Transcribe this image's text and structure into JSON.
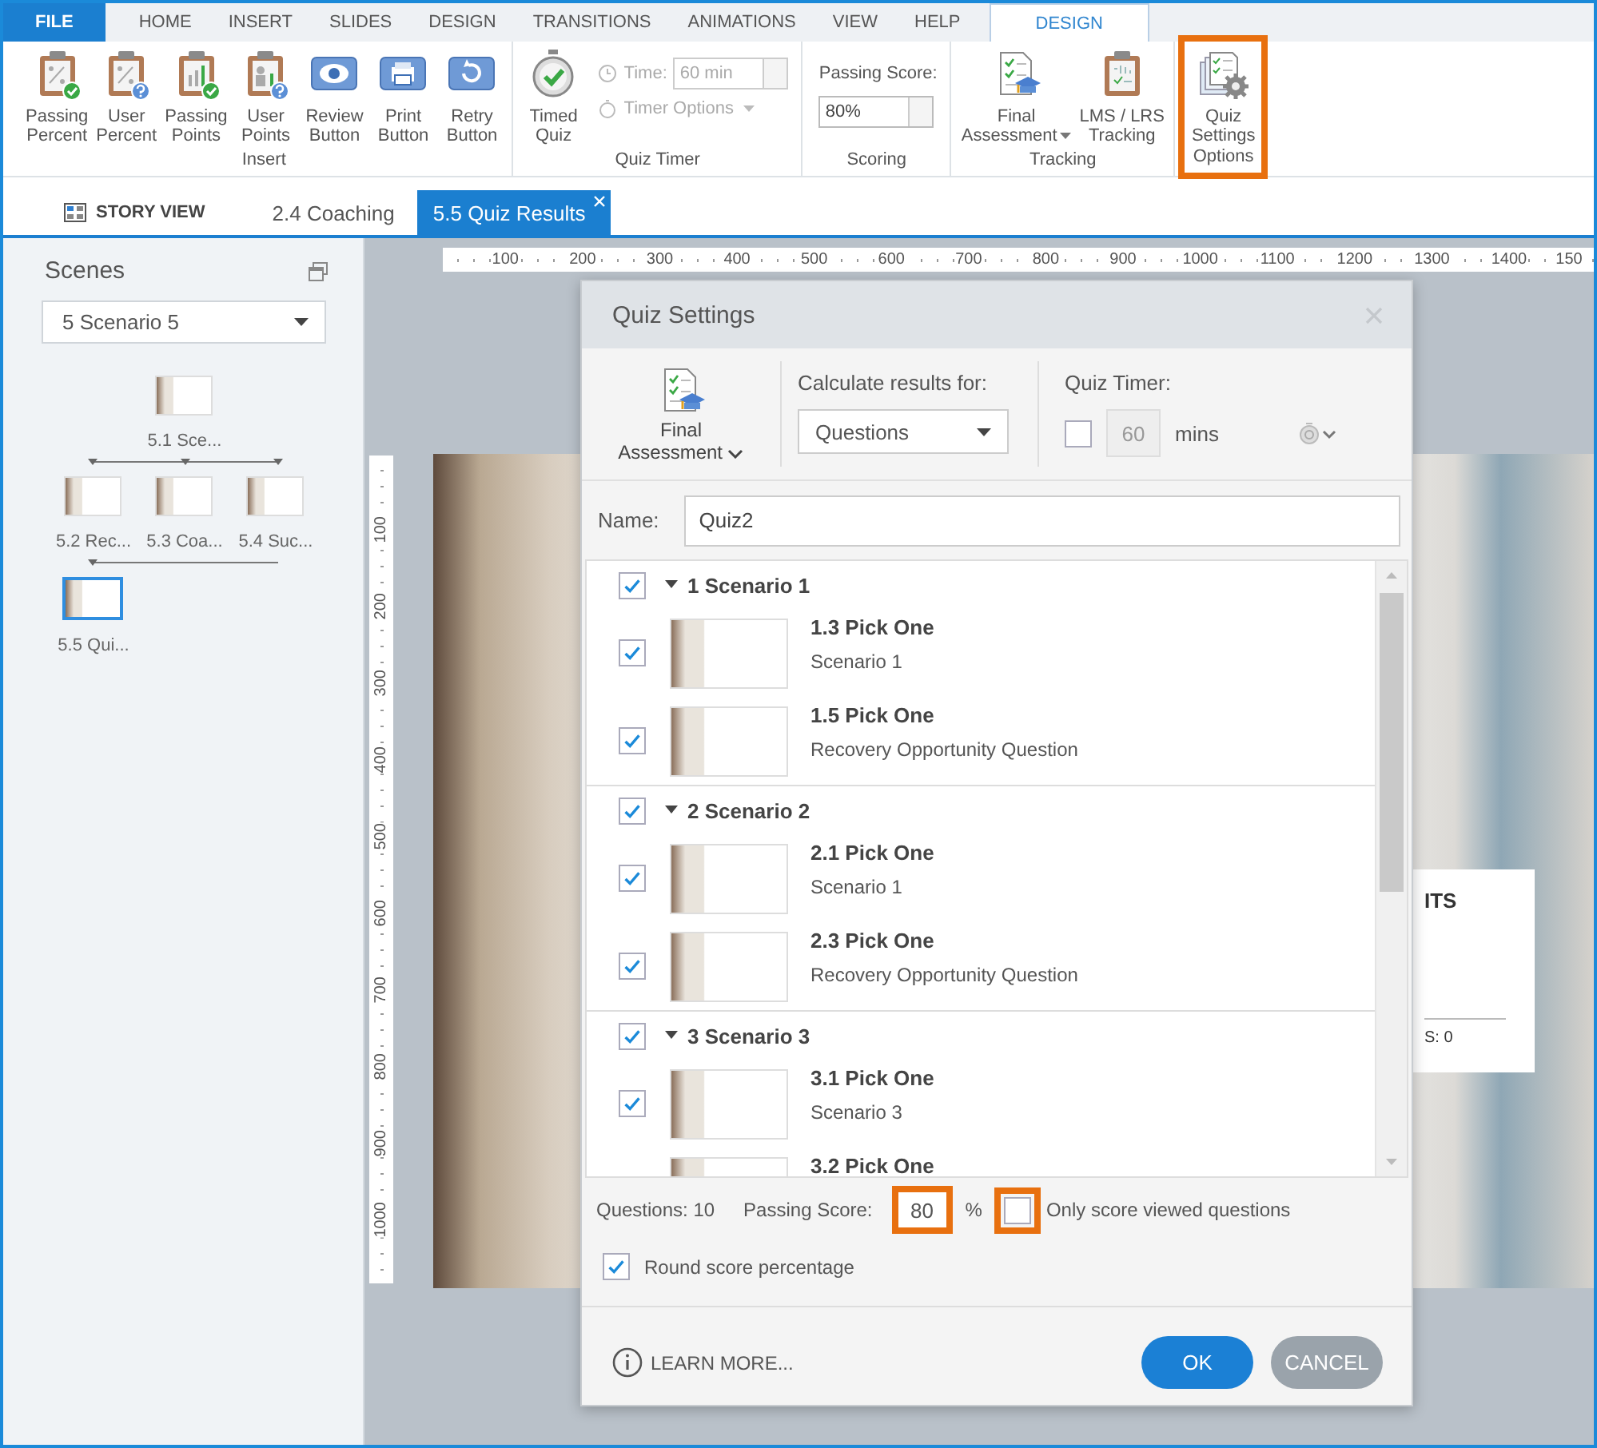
{
  "ribbon": {
    "tabs": [
      {
        "label": "FILE",
        "kind": "file",
        "selected": false
      },
      {
        "label": "HOME",
        "kind": "plain",
        "selected": false
      },
      {
        "label": "INSERT",
        "kind": "plain",
        "selected": false
      },
      {
        "label": "SLIDES",
        "kind": "plain",
        "selected": false
      },
      {
        "label": "DESIGN",
        "kind": "plain",
        "selected": false
      },
      {
        "label": "TRANSITIONS",
        "kind": "plain",
        "selected": false
      },
      {
        "label": "ANIMATIONS",
        "kind": "plain",
        "selected": false
      },
      {
        "label": "VIEW",
        "kind": "plain",
        "selected": false
      },
      {
        "label": "HELP",
        "kind": "plain",
        "selected": false
      },
      {
        "label": "DESIGN",
        "kind": "contextual",
        "selected": true
      }
    ],
    "groups": [
      {
        "label": "Insert",
        "highlighted": false,
        "items": [
          {
            "kind": "button",
            "label": "Passing\nPercent"
          },
          {
            "kind": "button",
            "label": "User\nPercent"
          },
          {
            "kind": "button",
            "label": "Passing\nPoints"
          },
          {
            "kind": "button",
            "label": "User\nPoints"
          },
          {
            "kind": "button",
            "label": "Review\nButton"
          },
          {
            "kind": "button",
            "label": "Print\nButton"
          },
          {
            "kind": "button",
            "label": "Retry\nButton"
          }
        ]
      },
      {
        "label": "Quiz Timer",
        "highlighted": false,
        "items": [
          {
            "kind": "button",
            "label": "Timed\nQuiz"
          },
          {
            "kind": "spin",
            "label": "Time:",
            "value": "60 min",
            "disabled": true
          },
          {
            "kind": "menu",
            "label": "Timer Options",
            "disabled": true
          }
        ]
      },
      {
        "label": "Scoring",
        "highlighted": false,
        "items": [
          {
            "kind": "field",
            "label": "Passing Score:",
            "value": "80%"
          }
        ]
      },
      {
        "label": "Tracking",
        "highlighted": false,
        "items": [
          {
            "kind": "button",
            "label": "Final\nAssessment",
            "dropdown": true
          },
          {
            "kind": "button",
            "label": "LMS / LRS\nTracking",
            "dropdown": false
          }
        ]
      },
      {
        "label": "Options",
        "highlighted": true,
        "items": [
          {
            "kind": "button",
            "label": "Quiz\nSettings",
            "dropdown": false
          }
        ]
      }
    ]
  },
  "doc_tabs": [
    {
      "label": "STORY VIEW",
      "kind": "story",
      "selected": false,
      "closable": false
    },
    {
      "label": "2.4 Coaching",
      "kind": "slide",
      "selected": false,
      "closable": false
    },
    {
      "label": "5.5 Quiz Results",
      "kind": "slide",
      "selected": true,
      "closable": true
    }
  ],
  "sidebar": {
    "title": "Scenes",
    "scene_select": "5 Scenario 5",
    "scene_rows": [
      {
        "scenes": [
          {
            "label": "5.1 Sce...",
            "selected": false
          }
        ]
      },
      {
        "scenes": [
          {
            "label": "5.2 Rec...",
            "selected": false
          },
          {
            "label": "5.3 Coa...",
            "selected": false
          },
          {
            "label": "5.4 Suc...",
            "selected": false
          }
        ]
      },
      {
        "scenes": [
          {
            "label": "5.5 Qui...",
            "selected": true
          }
        ]
      }
    ]
  },
  "ruler_h": [
    "100",
    "200",
    "300",
    "400",
    "500",
    "600",
    "700",
    "800",
    "900",
    "1000",
    "1100",
    "1200",
    "1300",
    "1400",
    "150"
  ],
  "ruler_v": [
    "100",
    "200",
    "300",
    "400",
    "500",
    "600",
    "700",
    "800",
    "900",
    "1000"
  ],
  "slide_card": {
    "heading": "ITS",
    "score": "S: 0"
  },
  "dialog": {
    "title": "Quiz Settings",
    "assessment": {
      "label": "Final\nAssessment"
    },
    "calculate": {
      "label": "Calculate results for:",
      "value": "Questions"
    },
    "timer": {
      "label": "Quiz Timer:",
      "checked": false,
      "value": "60",
      "unit": "mins"
    },
    "name": {
      "label": "Name:",
      "value": "Quiz2"
    },
    "groups": [
      {
        "title": "1 Scenario 1",
        "checked": true,
        "expanded": true,
        "items": [
          {
            "title": "1.3 Pick One",
            "subtitle": "Scenario 1",
            "checked": true
          },
          {
            "title": "1.5 Pick One",
            "subtitle": "Recovery Opportunity Question",
            "checked": true
          }
        ]
      },
      {
        "title": "2 Scenario 2",
        "checked": true,
        "expanded": true,
        "items": [
          {
            "title": "2.1 Pick One",
            "subtitle": "Scenario 1",
            "checked": true
          },
          {
            "title": "2.3 Pick One",
            "subtitle": "Recovery Opportunity Question",
            "checked": true
          }
        ]
      },
      {
        "title": "3 Scenario 3",
        "checked": true,
        "expanded": true,
        "items": [
          {
            "title": "3.1 Pick One",
            "subtitle": "Scenario 3",
            "checked": true
          },
          {
            "title": "3.2 Pick One"
          }
        ]
      }
    ],
    "footer": {
      "questions": "Questions: 10",
      "passing_label": "Passing Score:",
      "passing_value": "80",
      "passing_highlighted": true,
      "percent": "%",
      "only_viewed": {
        "label": "Only score viewed questions",
        "checked": false,
        "highlighted": true
      },
      "round": {
        "label": "Round score percentage",
        "checked": true
      }
    },
    "learn_more": "LEARN MORE...",
    "buttons": [
      {
        "label": "OK",
        "kind": "primary"
      },
      {
        "label": "CANCEL",
        "kind": "secondary"
      }
    ]
  }
}
